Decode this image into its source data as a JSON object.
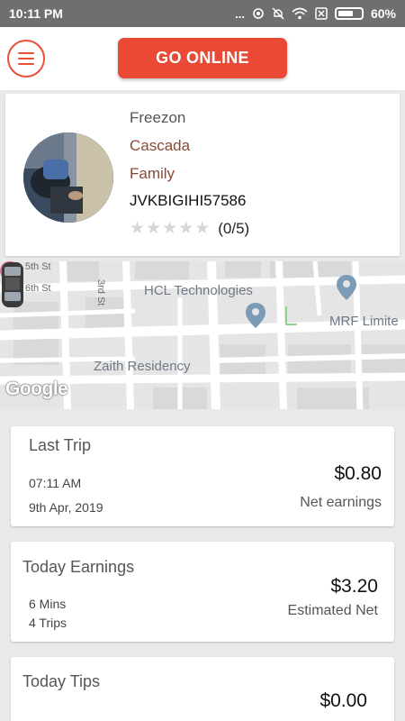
{
  "status_bar": {
    "time": "10:11 PM",
    "dots": "...",
    "battery_pct": "60%"
  },
  "header": {
    "go_online_label": "GO ONLINE"
  },
  "profile": {
    "line1": "Freezon",
    "line2": "Cascada",
    "line3": "Family",
    "plate": "JVKBIGIHI57586",
    "rating_text": "(0/5)",
    "stars_filled": 0,
    "stars_total": 5
  },
  "map": {
    "labels": {
      "street1": "Gaa 5th St",
      "street2": "Gaa 6th St",
      "street3": "3rd St",
      "poi1": "HCL Technologies",
      "poi2": "MRF Limite",
      "poi3": "Zaith Residency"
    },
    "logo": "Google"
  },
  "last_trip": {
    "title": "Last Trip",
    "time": "07:11 AM",
    "date": "9th Apr, 2019",
    "amount": "$0.80",
    "amount_label": "Net earnings"
  },
  "today_earnings": {
    "title": "Today Earnings",
    "duration": "6 Mins",
    "trips": "4 Trips",
    "amount": "$3.20",
    "amount_label": "Estimated Net"
  },
  "today_tips": {
    "title": "Today Tips",
    "amount": "$0.00"
  },
  "colors": {
    "accent": "#ea4a35",
    "status_bar": "#6f6f6f",
    "name_brown": "#8b4a35"
  }
}
